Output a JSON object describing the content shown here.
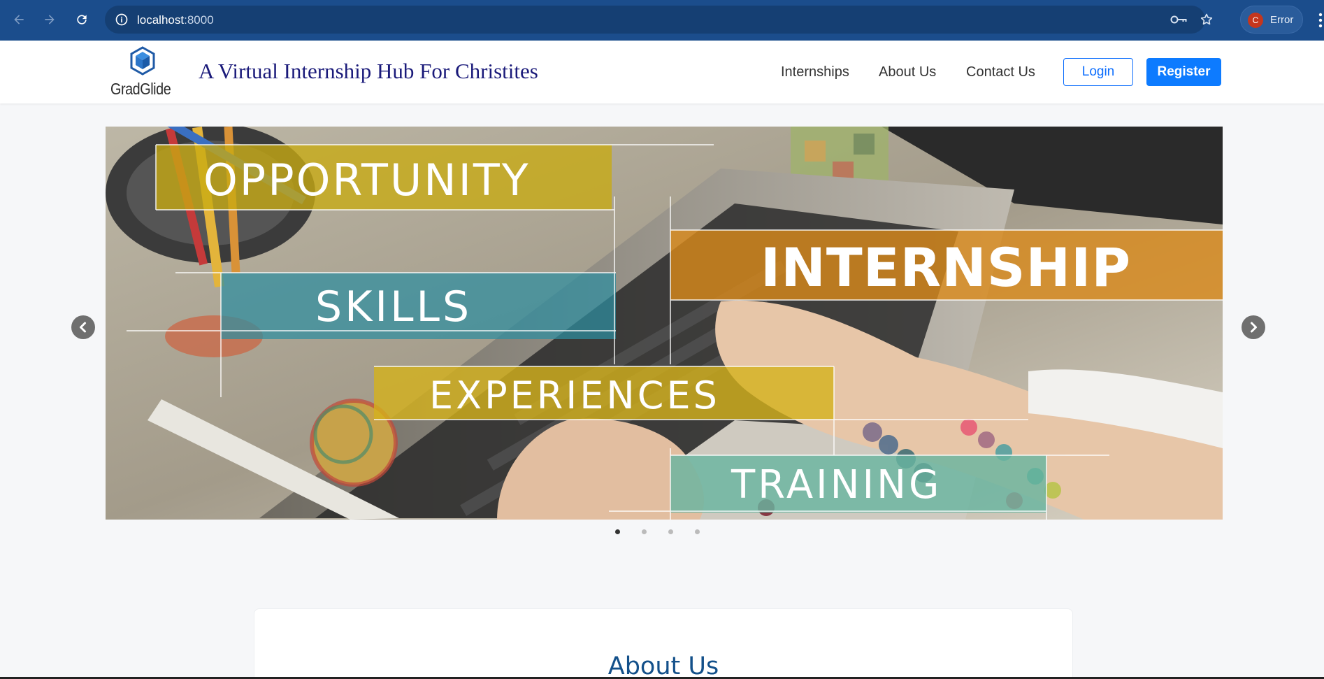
{
  "browser": {
    "url_host": "localhost",
    "url_port": ":8000",
    "profile_initial": "C",
    "profile_status": "Error"
  },
  "site": {
    "logo_text": "GradGlide",
    "tagline": "A Virtual Internship Hub For Christites",
    "nav": [
      {
        "label": "Internships"
      },
      {
        "label": "About Us"
      },
      {
        "label": "Contact Us"
      }
    ],
    "login_label": "Login",
    "register_label": "Register"
  },
  "carousel": {
    "slide_words": [
      "OPPORTUNITY",
      "INTERNSHIP",
      "SKILLS",
      "EXPERIENCES",
      "TRAINING"
    ],
    "active_index": 0,
    "slide_count": 4
  },
  "about": {
    "title": "About Us"
  },
  "colors": {
    "chrome": "#1b4d8c",
    "primary": "#0d6efd",
    "tagline": "#1a1a7a",
    "about_title": "#13508a"
  }
}
